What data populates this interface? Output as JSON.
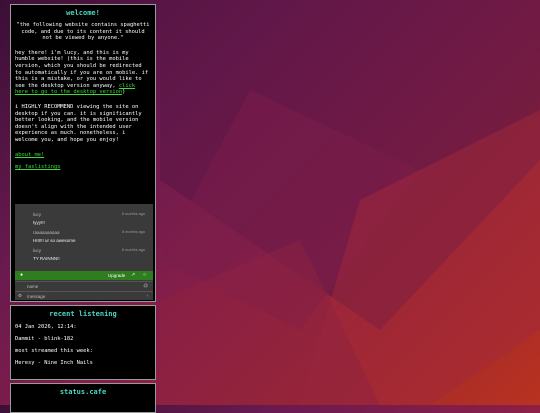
{
  "welcome": {
    "title": "welcome!",
    "quote": "\"the following website contains spaghetti code, and due to its content it should not be viewed by anyone.\"",
    "intro": "hey there! i'm lucy, and this is my humble website! (this is the mobile version, which you should be redirected to automatically if you are on mobile. if this is a mistake, or you would like to see the desktop version anyway, ",
    "desktop_link": "click here to go to the desktop version",
    "intro_end": ")",
    "recommend": "i HIGHLY RECOMMEND viewing the site on desktop if you can. it is significantly better looking, and the mobile version doesn't align with the intended user experience as much. nonetheless, i welcome you, and hope you enjoy!",
    "about_link": "about me!",
    "faslistings_link": "my faslistings"
  },
  "chat": {
    "messages": [
      {
        "name": "lucy",
        "time": "8 months ago",
        "text": "tyyy!!!"
      },
      {
        "name": "raaaaaaaaaa",
        "time": "8 months ago",
        "text": "HIII!!! ur so awesome"
      },
      {
        "name": "lucy",
        "time": "8 months ago",
        "text": "TY RAINNN!!"
      }
    ],
    "upgrade_label": "Upgrade",
    "name_placeholder": "name",
    "message_placeholder": "message"
  },
  "listening": {
    "title": "recent listening",
    "timestamp": "04 Jan 2026, 12:14:",
    "track": "Dammit - blink-182",
    "most_label": "most streamed this week:",
    "most_track": "Heresy - Nine Inch Nails"
  },
  "status": {
    "title": "status.cafe"
  },
  "colors": {
    "title": "#4fd6c0",
    "link": "#3cdc3c",
    "chatbar": "#2e7d1e"
  }
}
